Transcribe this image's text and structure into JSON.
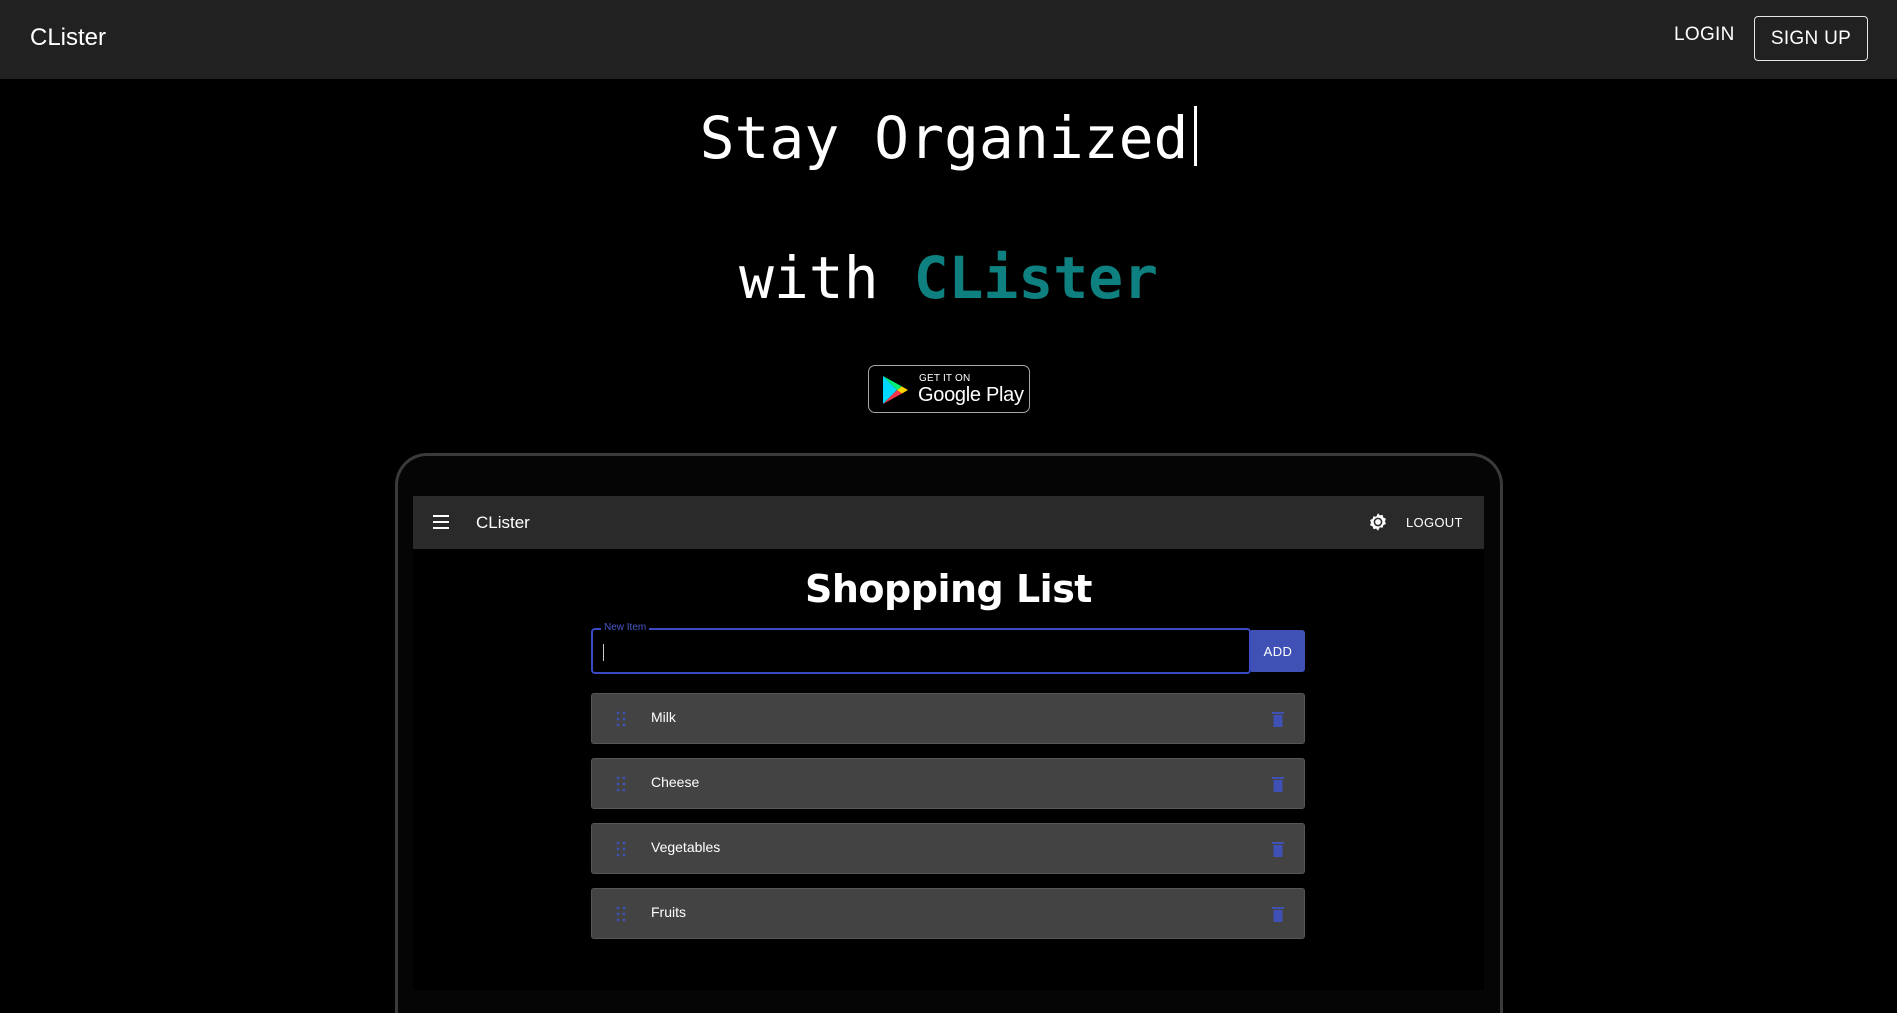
{
  "header": {
    "brand": "CLister",
    "login_label": "LOGIN",
    "signup_label": "SIGN UP"
  },
  "hero": {
    "line1": "Stay Organized",
    "line2_prefix": "with ",
    "line2_accent": "CLister",
    "accent_color": "#0f8080"
  },
  "store_badge": {
    "top_text": "GET IT ON",
    "main_text": "Google Play",
    "icon": "google-play-icon"
  },
  "app_preview": {
    "app_bar": {
      "menu_icon": "menu-icon",
      "title": "CLister",
      "settings_icon": "gear-icon",
      "logout_label": "LOGOUT"
    },
    "title": "Shopping List",
    "new_item": {
      "label": "New Item",
      "value": ""
    },
    "add_label": "ADD",
    "primary_color": "#3f51b5",
    "items": [
      {
        "label": "Milk"
      },
      {
        "label": "Cheese"
      },
      {
        "label": "Vegetables"
      },
      {
        "label": "Fruits"
      }
    ]
  }
}
